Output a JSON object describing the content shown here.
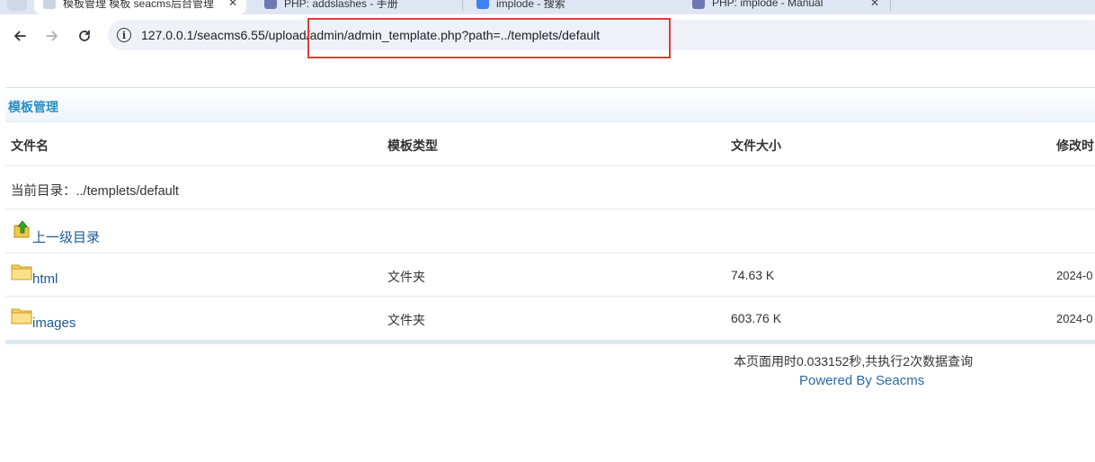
{
  "browser": {
    "tabs": [
      {
        "title": "模板管理 模板 seacms后台管理",
        "active": true
      },
      {
        "title": "PHP: addslashes - 手册"
      },
      {
        "title": "implode - 搜索"
      },
      {
        "title": "PHP: implode - Manual"
      }
    ],
    "url": "127.0.0.1/seacms6.55/upload/admin/admin_template.php?path=../templets/default",
    "info_icon_glyph": "i"
  },
  "panel": {
    "title": "模板管理"
  },
  "table": {
    "headers": [
      "文件名",
      "模板类型",
      "文件大小",
      "修改时"
    ],
    "current_dir_label": "当前目录：../templets/default",
    "parent_link": "上一级目录",
    "rows": [
      {
        "name": "html",
        "type": "文件夹",
        "size": "74.63 K",
        "modified": "2024-0"
      },
      {
        "name": "images",
        "type": "文件夹",
        "size": "603.76 K",
        "modified": "2024-0"
      }
    ]
  },
  "footer": {
    "stats": "本页面用时0.033152秒,共执行2次数据查询",
    "powered": "Powered By Seacms"
  },
  "colors": {
    "accent": "#2b8fc4",
    "link": "#1c5a94",
    "highlight_border": "#e03c3c",
    "folder": "#f5d060"
  },
  "icons": {
    "back": "back-arrow-icon",
    "forward": "forward-arrow-icon",
    "reload": "reload-icon",
    "info": "info-icon",
    "folder": "folder-icon",
    "parent": "folder-up-icon"
  }
}
